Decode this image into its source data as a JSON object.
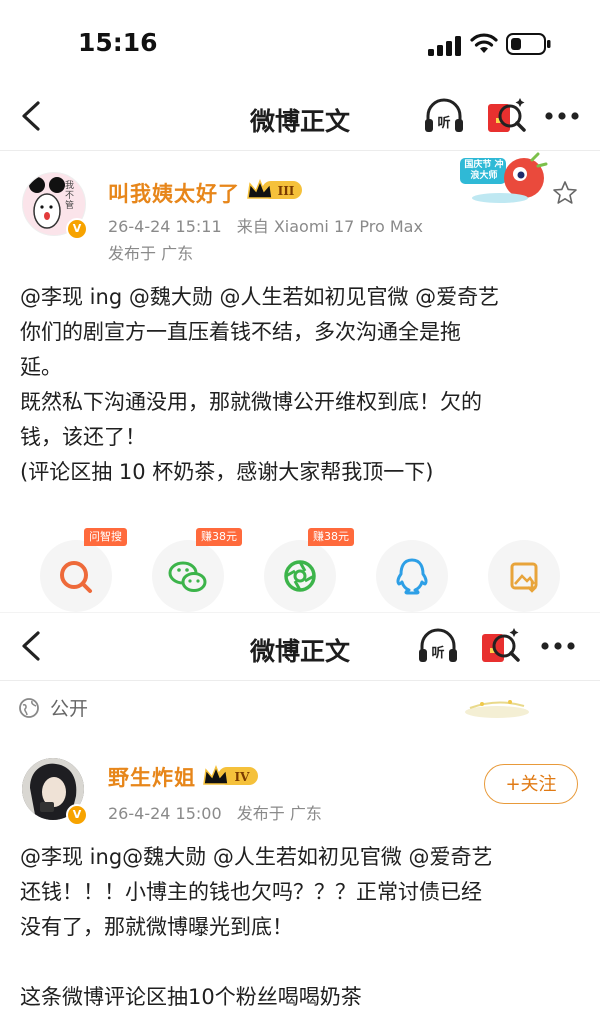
{
  "status_bar": {
    "time": "15:16"
  },
  "screen1": {
    "nav": {
      "title": "微博正文"
    },
    "post": {
      "username": "叫我姨太好了",
      "level": "III",
      "datetime": "26-4-24 15:11",
      "device": "来自 Xiaomi 17 Pro Max",
      "location": "发布于 广东",
      "avatar_text": "我不管",
      "badge_text": "国庆节 冲浪大师",
      "lines": [
        "@李现 ing @魏大勋 @人生若如初见官微 @爱奇艺",
        "你们的剧宣方一直压着钱不结，多次沟通全是拖",
        "延。",
        "既然私下沟通没用，那就微博公开维权到底！欠的",
        "钱，该还了！",
        "(评论区抽 10 杯奶茶，感谢大家帮我顶一下)"
      ]
    },
    "share": [
      {
        "tag": "问智搜",
        "icon": "ai-search-icon"
      },
      {
        "tag": "赚38元",
        "icon": "wechat-icon"
      },
      {
        "tag": "赚38元",
        "icon": "moments-icon"
      },
      {
        "tag": "",
        "icon": "qq-icon"
      },
      {
        "tag": "",
        "icon": "save-image-icon"
      }
    ]
  },
  "screen2": {
    "nav": {
      "title": "微博正文"
    },
    "visibility": "公开",
    "post": {
      "username": "野生炸姐",
      "level": "IV",
      "datetime": "26-4-24 15:00",
      "location": "发布于 广东",
      "follow_label": "+关注",
      "lines": [
        "@李现 ing@魏大勋 @人生若如初见官微 @爱奇艺",
        "还钱！！！小博主的钱也欠吗？？？正常讨债已经",
        "没有了，那就微博曝光到底！",
        "",
        "这条微博评论区抽10个粉丝喝喝奶茶"
      ]
    }
  },
  "colors": {
    "username": "#e7861a",
    "accent_orange": "#f7a300",
    "tag_red": "#ff6a3c"
  }
}
